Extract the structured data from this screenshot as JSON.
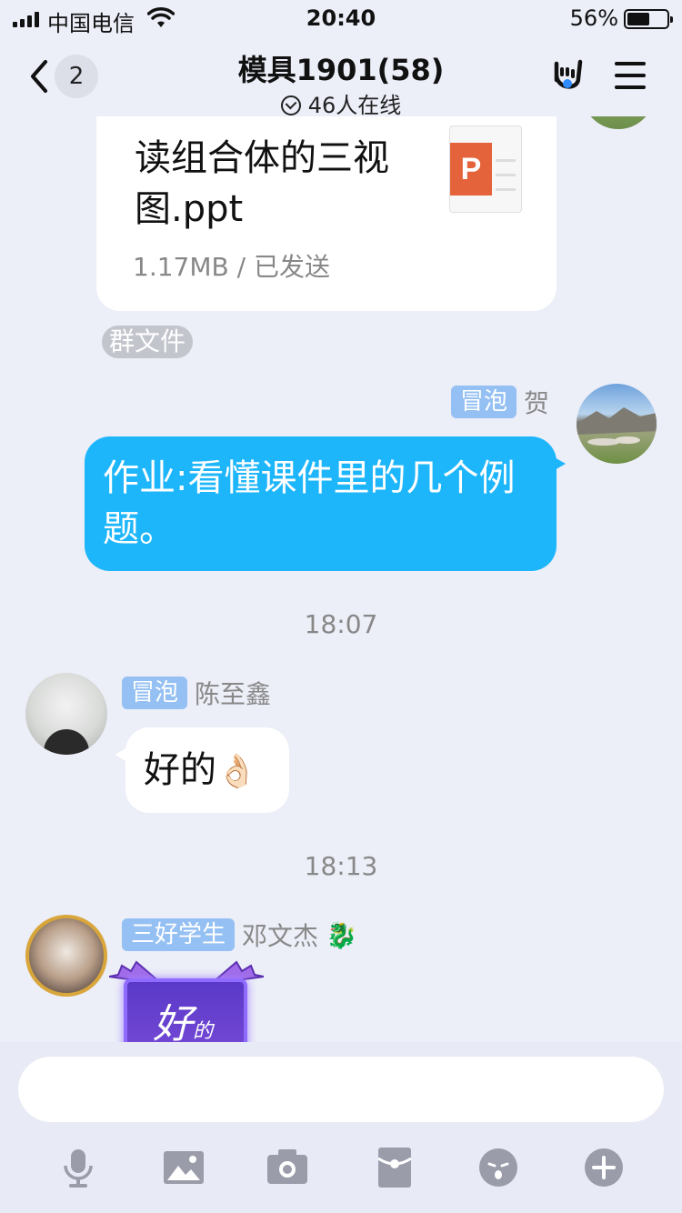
{
  "status_bar": {
    "carrier": "中国电信",
    "time": "20:40",
    "battery_percent": "56%",
    "battery_level": 0.56
  },
  "nav": {
    "back_count": "2",
    "title": "模具1901(58)",
    "subtitle": "46人在线"
  },
  "messages": {
    "file_card": {
      "name": "读组合体的三视图.ppt",
      "meta": "1.17MB / 已发送",
      "icon_letter": "P",
      "source_tag": "群文件"
    },
    "he": {
      "tag": "冒泡",
      "name": "贺",
      "text": "作业:看懂课件里的几个例题。"
    },
    "time_1": "18:07",
    "chen": {
      "tag": "冒泡",
      "name": "陈至鑫",
      "text": "好的",
      "emoji": "👌🏻"
    },
    "time_2": "18:13",
    "deng": {
      "tag": "三好学生",
      "name": "邓文杰",
      "badge_emoji": "🐉",
      "sticker_main": "好",
      "sticker_small": "的"
    }
  },
  "input": {
    "placeholder": ""
  },
  "toolbar": [
    "microphone-icon",
    "image-icon",
    "camera-icon",
    "red-packet-icon",
    "emoji-icon",
    "plus-icon"
  ],
  "colors": {
    "background": "#eceef8",
    "blue_bubble": "#1eb6fb",
    "tag_blue": "#95c0f3",
    "ppt_orange": "#e5633a",
    "tool_gray": "#9a9caa"
  }
}
